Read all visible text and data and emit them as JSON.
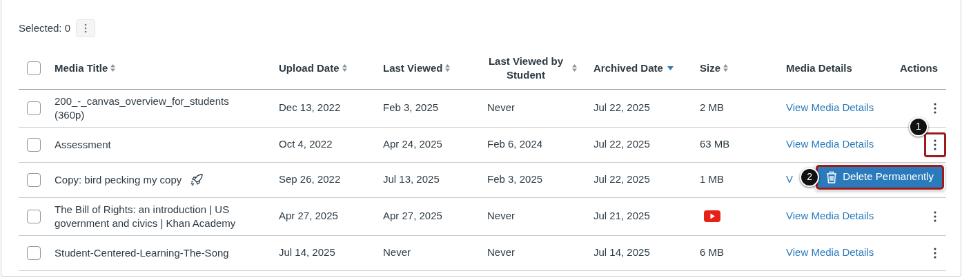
{
  "selection": {
    "label": "Selected: 0"
  },
  "columns": [
    {
      "label": "Media Title",
      "sortable": true,
      "sorted_descending": false
    },
    {
      "label": "Upload Date",
      "sortable": true,
      "sorted_descending": false
    },
    {
      "label": "Last Viewed",
      "sortable": true,
      "sorted_descending": false
    },
    {
      "label": "Last Viewed by Student",
      "sortable": true,
      "sorted_descending": false
    },
    {
      "label": "Archived Date",
      "sortable": true,
      "sorted_descending": true
    },
    {
      "label": "Size",
      "sortable": true,
      "sorted_descending": false
    },
    {
      "label": "Media Details"
    },
    {
      "label": "Actions"
    }
  ],
  "select_all": {
    "checked": false
  },
  "rows": [
    {
      "checked": false,
      "title": "200_-_canvas_overview_for_students (360p)",
      "upload": "Dec 13, 2022",
      "last_viewed": "Feb 3, 2025",
      "last_viewed_student": "Never",
      "archived": "Jul 22, 2025",
      "size": {
        "kind": "text",
        "text": "2 MB"
      },
      "details": "View Media Details"
    },
    {
      "checked": false,
      "title": "Assessment",
      "upload": "Oct 4, 2022",
      "last_viewed": "Apr 24, 2025",
      "last_viewed_student": "Feb 6, 2024",
      "archived": "Jul 22, 2025",
      "size": {
        "kind": "text",
        "text": "63 MB"
      },
      "details": "View Media Details",
      "highlighted": true,
      "callout": "1"
    },
    {
      "checked": false,
      "title": "Copy: bird pecking my copy",
      "title_icon": true,
      "upload": "Sep 26, 2022",
      "last_viewed": "Jul 13, 2025",
      "last_viewed_student": "Feb 3, 2025",
      "archived": "Jul 22, 2025",
      "size": {
        "kind": "text",
        "text": "1 MB"
      },
      "details": "V",
      "menu": {
        "label": "Delete Permanently",
        "callout": "2"
      }
    },
    {
      "checked": false,
      "title": "The Bill of Rights: an introduction | US government and civics | Khan Academy",
      "upload": "Apr 27, 2025",
      "last_viewed": "Apr 27, 2025",
      "last_viewed_student": "Never",
      "archived": "Jul 21, 2025",
      "size": {
        "kind": "video-logo"
      },
      "details": "View Media Details"
    },
    {
      "checked": false,
      "title": "Student-Centered-Learning-The-Song",
      "upload": "Jul 14, 2025",
      "last_viewed": "Never",
      "last_viewed_student": "Never",
      "archived": "Jul 14, 2025",
      "size": {
        "kind": "text",
        "text": "6 MB"
      },
      "details": "View Media Details"
    }
  ]
}
